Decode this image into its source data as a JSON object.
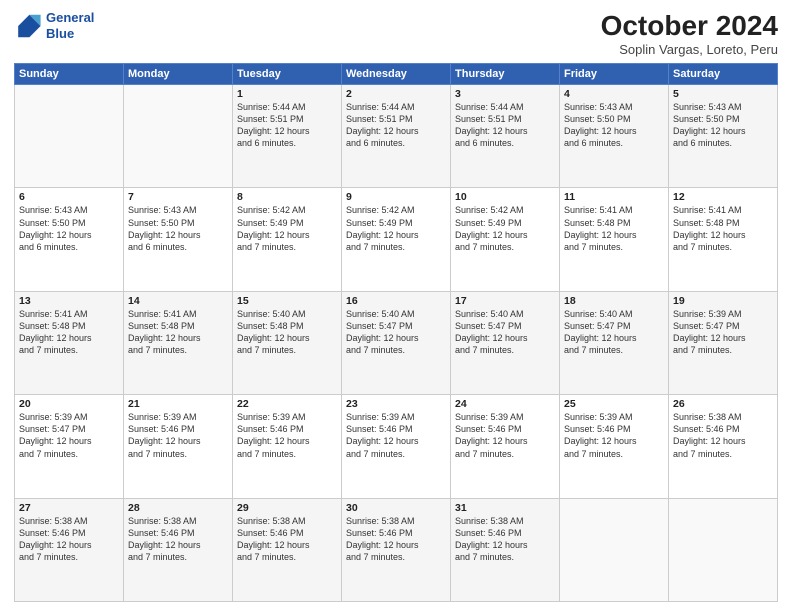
{
  "header": {
    "logo_line1": "General",
    "logo_line2": "Blue",
    "month": "October 2024",
    "location": "Soplin Vargas, Loreto, Peru"
  },
  "days_of_week": [
    "Sunday",
    "Monday",
    "Tuesday",
    "Wednesday",
    "Thursday",
    "Friday",
    "Saturday"
  ],
  "weeks": [
    [
      {
        "day": "",
        "info": ""
      },
      {
        "day": "",
        "info": ""
      },
      {
        "day": "1",
        "info": "Sunrise: 5:44 AM\nSunset: 5:51 PM\nDaylight: 12 hours\nand 6 minutes."
      },
      {
        "day": "2",
        "info": "Sunrise: 5:44 AM\nSunset: 5:51 PM\nDaylight: 12 hours\nand 6 minutes."
      },
      {
        "day": "3",
        "info": "Sunrise: 5:44 AM\nSunset: 5:51 PM\nDaylight: 12 hours\nand 6 minutes."
      },
      {
        "day": "4",
        "info": "Sunrise: 5:43 AM\nSunset: 5:50 PM\nDaylight: 12 hours\nand 6 minutes."
      },
      {
        "day": "5",
        "info": "Sunrise: 5:43 AM\nSunset: 5:50 PM\nDaylight: 12 hours\nand 6 minutes."
      }
    ],
    [
      {
        "day": "6",
        "info": "Sunrise: 5:43 AM\nSunset: 5:50 PM\nDaylight: 12 hours\nand 6 minutes."
      },
      {
        "day": "7",
        "info": "Sunrise: 5:43 AM\nSunset: 5:50 PM\nDaylight: 12 hours\nand 6 minutes."
      },
      {
        "day": "8",
        "info": "Sunrise: 5:42 AM\nSunset: 5:49 PM\nDaylight: 12 hours\nand 7 minutes."
      },
      {
        "day": "9",
        "info": "Sunrise: 5:42 AM\nSunset: 5:49 PM\nDaylight: 12 hours\nand 7 minutes."
      },
      {
        "day": "10",
        "info": "Sunrise: 5:42 AM\nSunset: 5:49 PM\nDaylight: 12 hours\nand 7 minutes."
      },
      {
        "day": "11",
        "info": "Sunrise: 5:41 AM\nSunset: 5:48 PM\nDaylight: 12 hours\nand 7 minutes."
      },
      {
        "day": "12",
        "info": "Sunrise: 5:41 AM\nSunset: 5:48 PM\nDaylight: 12 hours\nand 7 minutes."
      }
    ],
    [
      {
        "day": "13",
        "info": "Sunrise: 5:41 AM\nSunset: 5:48 PM\nDaylight: 12 hours\nand 7 minutes."
      },
      {
        "day": "14",
        "info": "Sunrise: 5:41 AM\nSunset: 5:48 PM\nDaylight: 12 hours\nand 7 minutes."
      },
      {
        "day": "15",
        "info": "Sunrise: 5:40 AM\nSunset: 5:48 PM\nDaylight: 12 hours\nand 7 minutes."
      },
      {
        "day": "16",
        "info": "Sunrise: 5:40 AM\nSunset: 5:47 PM\nDaylight: 12 hours\nand 7 minutes."
      },
      {
        "day": "17",
        "info": "Sunrise: 5:40 AM\nSunset: 5:47 PM\nDaylight: 12 hours\nand 7 minutes."
      },
      {
        "day": "18",
        "info": "Sunrise: 5:40 AM\nSunset: 5:47 PM\nDaylight: 12 hours\nand 7 minutes."
      },
      {
        "day": "19",
        "info": "Sunrise: 5:39 AM\nSunset: 5:47 PM\nDaylight: 12 hours\nand 7 minutes."
      }
    ],
    [
      {
        "day": "20",
        "info": "Sunrise: 5:39 AM\nSunset: 5:47 PM\nDaylight: 12 hours\nand 7 minutes."
      },
      {
        "day": "21",
        "info": "Sunrise: 5:39 AM\nSunset: 5:46 PM\nDaylight: 12 hours\nand 7 minutes."
      },
      {
        "day": "22",
        "info": "Sunrise: 5:39 AM\nSunset: 5:46 PM\nDaylight: 12 hours\nand 7 minutes."
      },
      {
        "day": "23",
        "info": "Sunrise: 5:39 AM\nSunset: 5:46 PM\nDaylight: 12 hours\nand 7 minutes."
      },
      {
        "day": "24",
        "info": "Sunrise: 5:39 AM\nSunset: 5:46 PM\nDaylight: 12 hours\nand 7 minutes."
      },
      {
        "day": "25",
        "info": "Sunrise: 5:39 AM\nSunset: 5:46 PM\nDaylight: 12 hours\nand 7 minutes."
      },
      {
        "day": "26",
        "info": "Sunrise: 5:38 AM\nSunset: 5:46 PM\nDaylight: 12 hours\nand 7 minutes."
      }
    ],
    [
      {
        "day": "27",
        "info": "Sunrise: 5:38 AM\nSunset: 5:46 PM\nDaylight: 12 hours\nand 7 minutes."
      },
      {
        "day": "28",
        "info": "Sunrise: 5:38 AM\nSunset: 5:46 PM\nDaylight: 12 hours\nand 7 minutes."
      },
      {
        "day": "29",
        "info": "Sunrise: 5:38 AM\nSunset: 5:46 PM\nDaylight: 12 hours\nand 7 minutes."
      },
      {
        "day": "30",
        "info": "Sunrise: 5:38 AM\nSunset: 5:46 PM\nDaylight: 12 hours\nand 7 minutes."
      },
      {
        "day": "31",
        "info": "Sunrise: 5:38 AM\nSunset: 5:46 PM\nDaylight: 12 hours\nand 7 minutes."
      },
      {
        "day": "",
        "info": ""
      },
      {
        "day": "",
        "info": ""
      }
    ]
  ]
}
